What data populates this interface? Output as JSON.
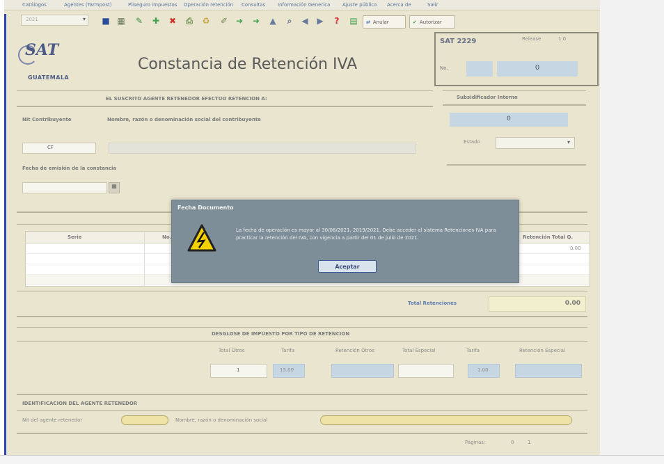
{
  "menu": [
    "Catálogos",
    "Agentes (Tarmpost)",
    "Pliseguro impuestos",
    "Operación retención",
    "Consultas",
    "Información Generica",
    "Ajuste público",
    "Acerca de",
    "Salir"
  ],
  "toolbar": {
    "combo_value": "2021",
    "buttons": [
      "save-icon",
      "calc-icon",
      "pencil-icon",
      "add-icon",
      "delete-icon",
      "print-icon",
      "clear-icon",
      "edit-icon",
      "green-arrow-icon",
      "green-arrow-icon",
      "up-icon",
      "search-icon",
      "back-icon",
      "forward-icon",
      "help-icon",
      "book-icon"
    ],
    "validate_label": "Anular",
    "submit_label": "Autorizar"
  },
  "header": {
    "logo_text": "SAT",
    "logo_country": "GUATEMALA",
    "title": "Constancia de Retención IVA",
    "form_code": "SAT 2229",
    "version_label": "Release",
    "version_value": "1.0",
    "no_label": "No.",
    "no_value": "0"
  },
  "section1": {
    "heading": "EL SUSCRITO AGENTE RETENEDOR EFECTUO RETENCION A:",
    "nit_label": "Nit Contribuyente",
    "name_label": "Nombre, razón o denominación social del contribuyente",
    "nit_value": "CF",
    "date_label": "Fecha de emisión de la constancia"
  },
  "side": {
    "heading": "Subsidificador Interno",
    "value": "0",
    "estado_label": "Estado"
  },
  "table": {
    "headers": [
      "Serie",
      "No.",
      "Retención Total Q."
    ],
    "first_value": "0.00"
  },
  "dialog": {
    "title": "Fecha Documento",
    "message": "La fecha de operación es mayor al 30/06/2021, 2019/2021. Debe acceder al sistema Retenciones IVA para practicar la retención del IVA, con vigencia a partir del 01 de julio de 2021.",
    "ok_label": "Aceptar"
  },
  "totals": {
    "label": "Total Retenciones",
    "value": "0.00"
  },
  "breakdown": {
    "heading": "DESGLOSE DE IMPUESTO POR TIPO DE RETENCION",
    "columns": [
      "Total Otros",
      "Tarifa",
      "Retención Otros",
      "Total Especial",
      "Tarifa",
      "Retención Especial"
    ],
    "total_otros": "1",
    "tarifa_otros": "15.00",
    "tarifa_especial": "1.00"
  },
  "agent": {
    "heading": "IDENTIFICACION DEL AGENTE RETENEDOR",
    "nit_label": "Nit del agente retenedor",
    "name_label": "Nombre, razón o denominación social"
  },
  "footer": {
    "pages_label": "Páginas:",
    "page_current": "0",
    "page_total": "1"
  },
  "colors": {
    "frame": "#e9e5cf",
    "dialog": "#7d8e99",
    "accent_blue": "#c6d6e3"
  }
}
